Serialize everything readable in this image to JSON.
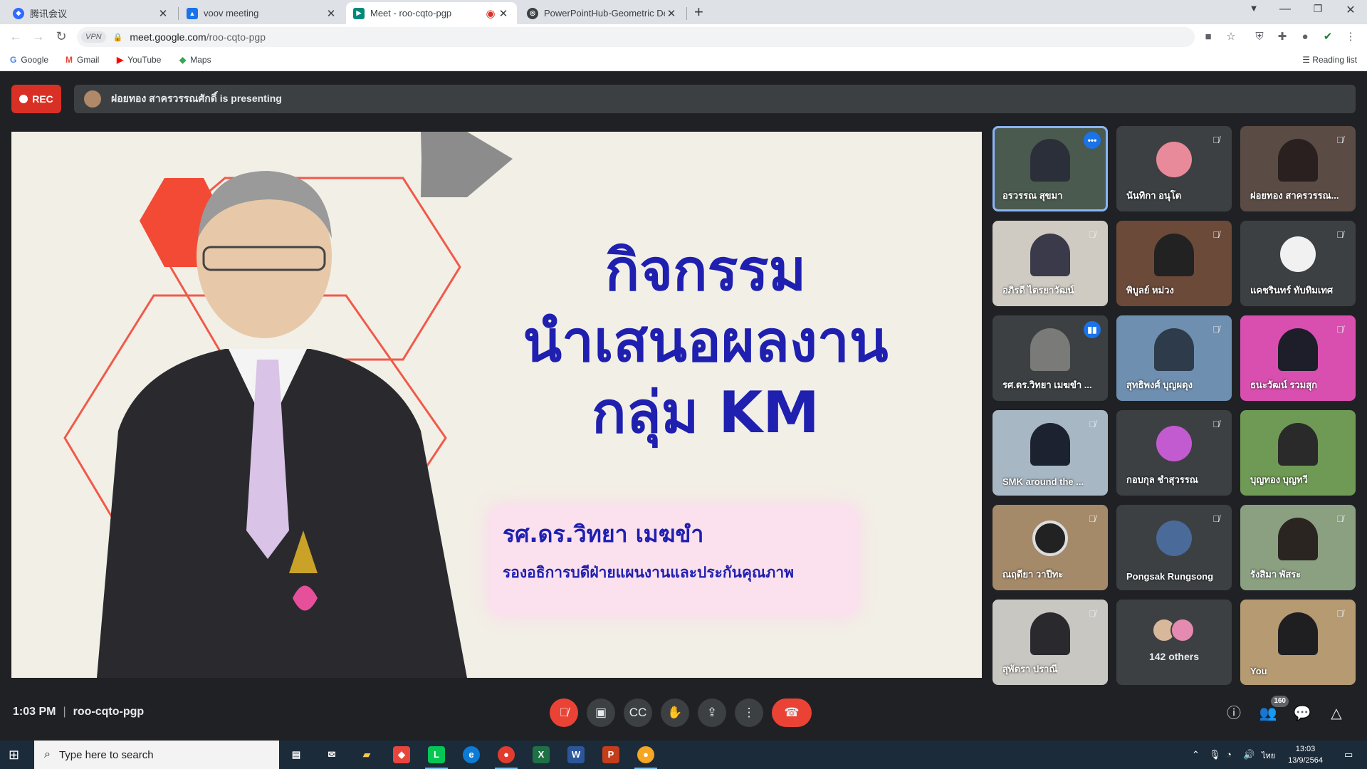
{
  "browser": {
    "tabs": [
      {
        "title": "腾讯会议",
        "icon": "tencent-meeting-icon"
      },
      {
        "title": "voov meeting",
        "icon": "voov-icon"
      },
      {
        "title": "Meet - roo-cqto-pgp",
        "icon": "google-meet-icon",
        "recording": true
      },
      {
        "title": "PowerPointHub-Geometric Desig",
        "icon": "globe-icon"
      }
    ],
    "address": {
      "vpn": "VPN",
      "host": "meet.google.com",
      "path": "/roo-cqto-pgp"
    },
    "bookmarks": [
      {
        "label": "Google",
        "icon": "google-icon"
      },
      {
        "label": "Gmail",
        "icon": "gmail-icon"
      },
      {
        "label": "YouTube",
        "icon": "youtube-icon"
      },
      {
        "label": "Maps",
        "icon": "maps-icon"
      }
    ],
    "reading_list": "Reading list"
  },
  "meet": {
    "rec_label": "REC",
    "presenting_text": "ฝอยทอง สาครวรรณศักดิ์ is presenting",
    "slide": {
      "title_lines": [
        "กิจกรรม",
        "นำเสนอผลงาน",
        "กลุ่ม KM"
      ],
      "presenter_name": "รศ.ดร.วิทยา เมฆขำ",
      "presenter_role": "รองอธิการบดีฝ่ายแผนงานและประกันคุณภาพ"
    },
    "participants": [
      {
        "name": "อรวรรณ สุขมา",
        "state": "more"
      },
      {
        "name": "นันทิกา อนุโต",
        "state": "muted"
      },
      {
        "name": "ฝอยทอง สาครวรรณ...",
        "state": "muted"
      },
      {
        "name": "อภิรดี ไตรยาวัฒน์",
        "state": "muted"
      },
      {
        "name": "พิบูลย์ หม่วง",
        "state": "muted"
      },
      {
        "name": "แคชรินทร์ ทับทิมเทศ",
        "state": "muted"
      },
      {
        "name": "รศ.ดร.วิทยา เมฆขำ ...",
        "state": "speaking"
      },
      {
        "name": "สุทธิพงศ์ บุญผดุง",
        "state": "muted"
      },
      {
        "name": "ธนะวัฒน์ รวมสุก",
        "state": "muted"
      },
      {
        "name": "SMK around the ...",
        "state": "muted"
      },
      {
        "name": "กอบกุล ชำสุวรรณ",
        "state": "muted"
      },
      {
        "name": "บุญทอง บุญทวี",
        "state": "none"
      },
      {
        "name": "ณฤดียา วาปีทะ",
        "state": "muted"
      },
      {
        "name": "Pongsak Rungsong",
        "state": "muted"
      },
      {
        "name": "รังสิมา พัสระ",
        "state": "muted"
      },
      {
        "name": "สุพัตรา ปราณี",
        "state": "muted"
      },
      {
        "name": "142 others",
        "state": "others"
      },
      {
        "name": "You",
        "state": "muted"
      }
    ],
    "time": "1:03 PM",
    "meeting_code": "roo-cqto-pgp",
    "people_count": "160",
    "colors": {
      "rec": "#d93025",
      "end_call": "#ea4335",
      "accent": "#8ab4f8",
      "slide_text": "#1f1fb0"
    }
  },
  "taskbar": {
    "search_placeholder": "Type here to search",
    "lang": "ไทย",
    "time": "13:03",
    "date": "13/9/2564"
  }
}
